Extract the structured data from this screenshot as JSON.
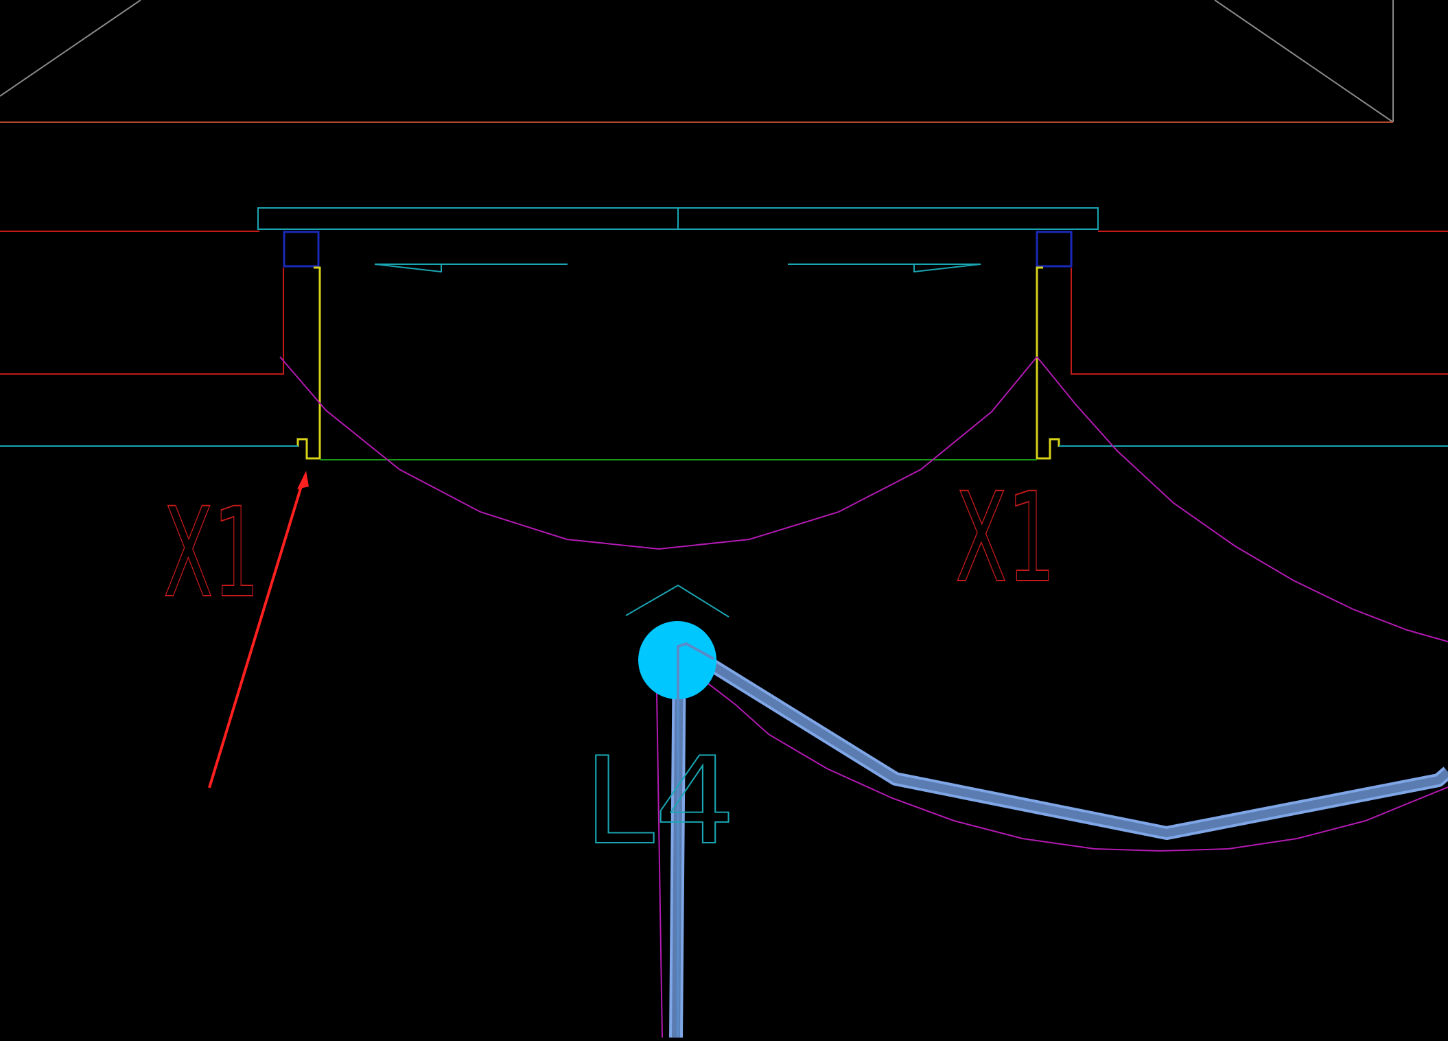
{
  "drawing": {
    "background": "#000000",
    "colors": {
      "roof": "#8a8a8a",
      "wall": "#c41a1a",
      "brown_line": "#b0472a",
      "cyan": "#1aa6b3",
      "frame_blue": "#1a2ab8",
      "yellow": "#d8d41a",
      "green": "#1a9a1a",
      "magenta": "#b31ab3",
      "arrow": "#ff2020",
      "highlight_fill": "#00c8ff",
      "highlight_path": "#7fa6e6"
    },
    "labels": {
      "left_tag": "X1",
      "right_tag": "X1",
      "line_tag": "L4"
    },
    "icons": {
      "selection_grip": "circle-grip-icon",
      "annotation_arrow": "red-arrow-icon"
    }
  }
}
